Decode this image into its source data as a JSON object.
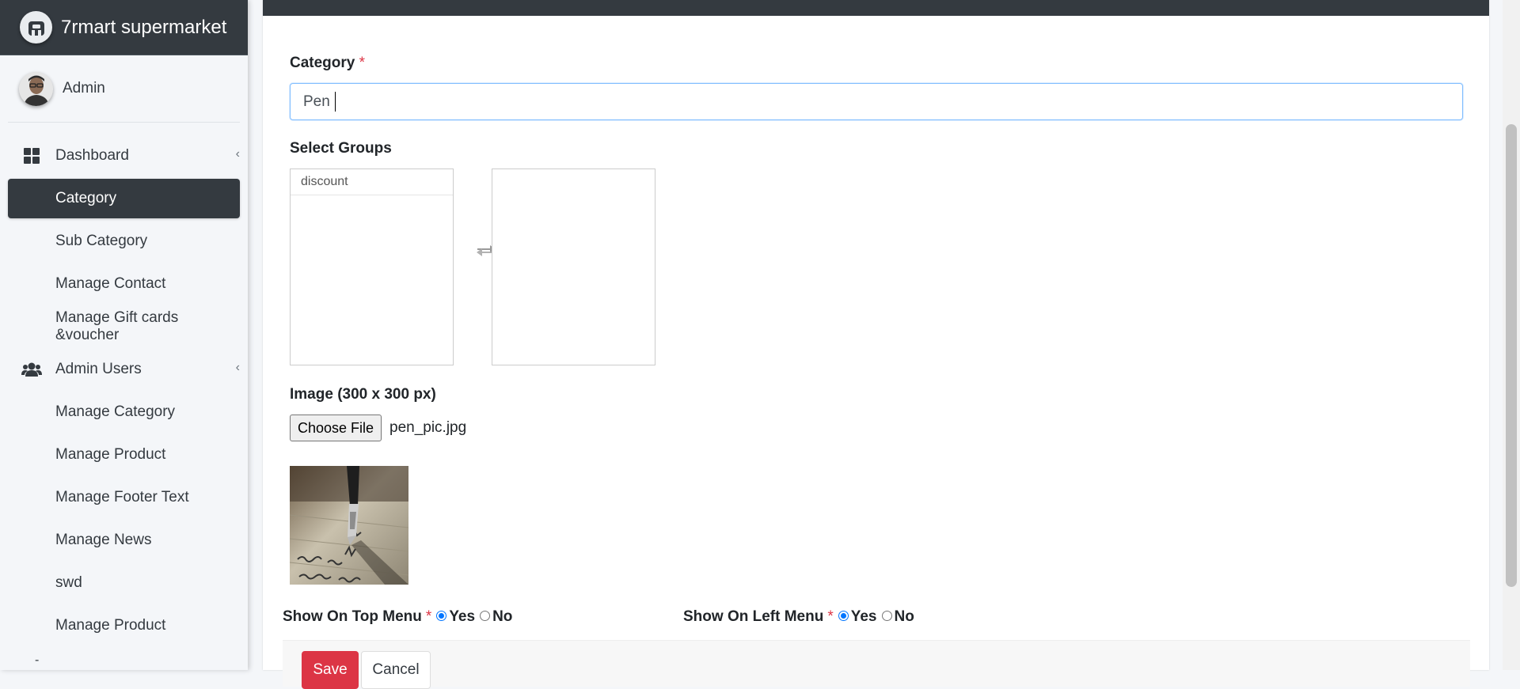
{
  "brand": {
    "name": "7rmart supermarket",
    "logo_icon": "adminlte-logo-icon"
  },
  "user": {
    "name": "Admin"
  },
  "sidebar": {
    "items": [
      {
        "label": "Dashboard",
        "icon": "dashboard-icon",
        "type": "group",
        "has_caret": true
      },
      {
        "label": "Category",
        "type": "sub",
        "active": true
      },
      {
        "label": "Sub Category",
        "type": "sub"
      },
      {
        "label": "Manage Contact",
        "type": "sub"
      },
      {
        "label": "Manage Gift cards &voucher",
        "type": "sub"
      },
      {
        "label": "Admin Users",
        "icon": "users-icon",
        "type": "group",
        "has_caret": true
      },
      {
        "label": "Manage Category",
        "type": "sub"
      },
      {
        "label": "Manage Product",
        "type": "sub"
      },
      {
        "label": "Manage Footer Text",
        "type": "sub"
      },
      {
        "label": "Manage News",
        "type": "sub"
      },
      {
        "label": "swd",
        "type": "sub"
      },
      {
        "label": "Manage Product",
        "type": "sub"
      }
    ],
    "trailing": "-"
  },
  "form": {
    "category_label": "Category",
    "required_mark": "*",
    "category_value": "Pen",
    "select_groups_label": "Select Groups",
    "available_groups": [
      "discount"
    ],
    "selected_groups": [],
    "swap_icon": "swap-arrows-icon",
    "image_label": "Image (300 x 300 px)",
    "choose_file_label": "Choose File",
    "file_name": "pen_pic.jpg",
    "top_menu": {
      "label": "Show On Top Menu",
      "yes": "Yes",
      "no": "No",
      "selected": "Yes"
    },
    "left_menu": {
      "label": "Show On Left Menu",
      "yes": "Yes",
      "no": "No",
      "selected": "Yes"
    },
    "save_label": "Save",
    "cancel_label": "Cancel"
  },
  "colors": {
    "dark": "#343a40",
    "danger": "#dc3545",
    "primary": "#0075ff",
    "focus_border": "#80bdff"
  }
}
